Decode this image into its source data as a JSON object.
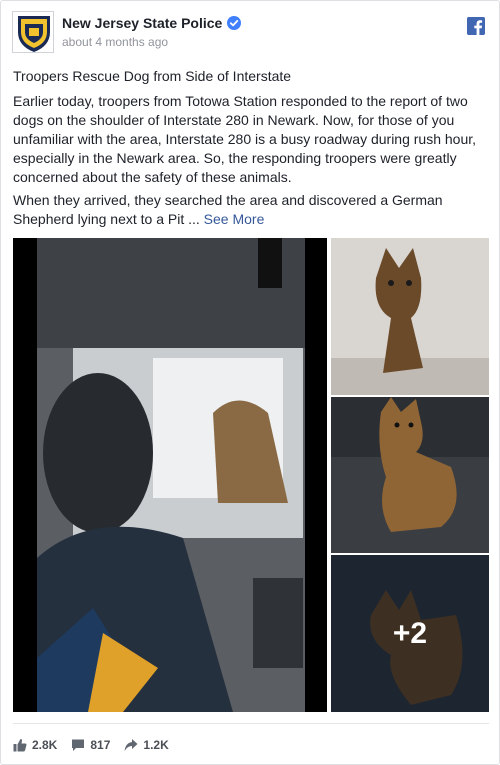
{
  "header": {
    "page_name": "New Jersey State Police",
    "timestamp": "about 4 months ago",
    "avatar_text": "STATE TROOPER"
  },
  "post": {
    "title": "Troopers Rescue Dog from Side of Interstate",
    "body": "Earlier today, troopers from Totowa Station responded to the report of two dogs on the shoulder of Interstate 280 in Newark. Now, for those of you unfamiliar with the area, Interstate 280 is a busy roadway during rush hour, especially in the Newark area. So, the responding troopers were greatly concerned about the safety of these animals.",
    "more": "When they arrived, they searched the area and discovered a German Shepherd lying next to a Pit ...",
    "see_more": "See More"
  },
  "media": {
    "extra_count": "+2"
  },
  "actions": {
    "likes": "2.8K",
    "comments": "817",
    "shares": "1.2K"
  },
  "colors": {
    "link": "#365899",
    "facebook_blue": "#4267b2",
    "verified": "#4080ff",
    "muted": "#90949c"
  }
}
